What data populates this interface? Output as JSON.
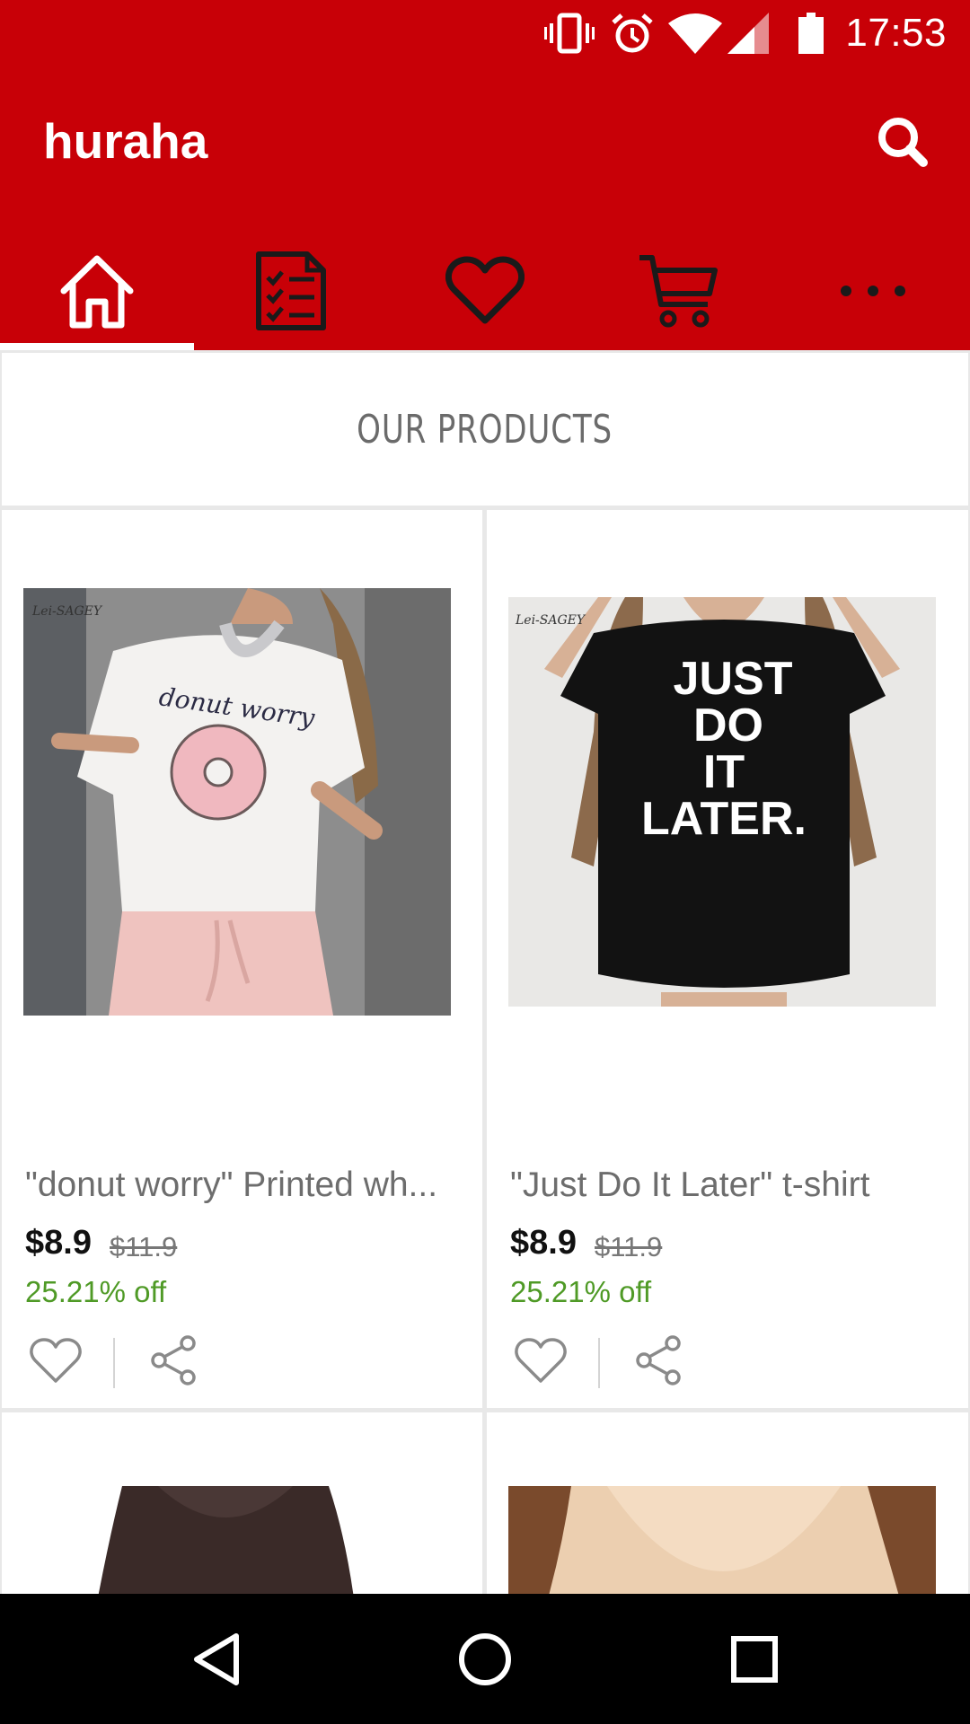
{
  "status_bar": {
    "time": "17:53",
    "icons": [
      "vibrate-icon",
      "alarm-icon",
      "wifi-icon",
      "signal-icon",
      "battery-icon"
    ]
  },
  "app_bar": {
    "title": "huraha",
    "search_icon": "search-icon",
    "tabs": [
      {
        "icon": "home-icon",
        "selected": true
      },
      {
        "icon": "orders-list-icon",
        "selected": false
      },
      {
        "icon": "heart-icon",
        "selected": false
      },
      {
        "icon": "cart-icon",
        "selected": false
      },
      {
        "icon": "more-icon",
        "selected": false
      }
    ]
  },
  "section": {
    "title": "OUR PRODUCTS"
  },
  "products": [
    {
      "name": "\"donut worry\" Printed wh...",
      "price": "$8.9",
      "original_price": "$11.9",
      "discount": "25.21% off",
      "shirt_text": "donut worry",
      "brand_mark": "Lei-SAGEY"
    },
    {
      "name": "\"Just Do It Later\" t-shirt",
      "price": "$8.9",
      "original_price": "$11.9",
      "discount": "25.21% off",
      "shirt_text": [
        "JUST",
        "DO",
        "IT",
        "LATER."
      ],
      "brand_mark": "Lei-SAGEY"
    }
  ],
  "colors": {
    "primary": "#c80007",
    "discount_green": "#4f9a26",
    "tab_selected": "#ffffff",
    "tab_unselected": "#1a1a1a"
  },
  "nav_bar": {
    "icons": [
      "back-icon",
      "home-circle-icon",
      "recents-icon"
    ]
  }
}
